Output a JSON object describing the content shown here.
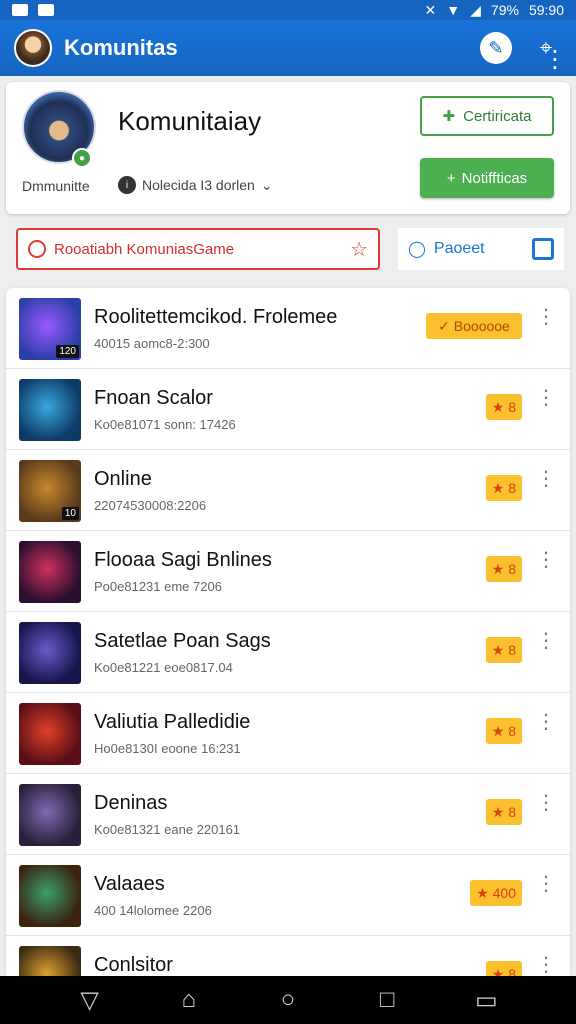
{
  "status": {
    "battery": "79%",
    "time": "59:90"
  },
  "appbar": {
    "title": "Komunitas",
    "button_icon": "edit-icon"
  },
  "profile": {
    "name": "Komunitaiay",
    "subtitle": "Dmmunitte",
    "meta": "Nolecida I3 dorlen",
    "certificate_label": "Certiricata",
    "notification_label": "Notiffticas"
  },
  "search": {
    "value": "Rooatiabh KomuniasGame",
    "post_label": "Paoeet"
  },
  "items": [
    {
      "title": "Roolitettemcikod. Frolemee",
      "subtitle": "40015 aomc8-2:300",
      "badge": "Boooooe",
      "thumb_badge": "120",
      "thumb_color1": "#2b3fa8",
      "thumb_color2": "#9b59ff"
    },
    {
      "title": "Fnoan Scalor",
      "subtitle": "Ko0e81071 sonn: 17426",
      "badge": "8",
      "thumb_badge": "",
      "thumb_color1": "#0d3b66",
      "thumb_color2": "#3aa7e0"
    },
    {
      "title": "Online",
      "subtitle": "22074530008:2206",
      "badge": "8",
      "thumb_badge": "10",
      "thumb_color1": "#5a3a1a",
      "thumb_color2": "#c8892f"
    },
    {
      "title": "Flooaa Sagi Bnlines",
      "subtitle": "Po0e81231 eme 7206",
      "badge": "8",
      "thumb_badge": "",
      "thumb_color1": "#2a0f2f",
      "thumb_color2": "#d03060"
    },
    {
      "title": "Satetlae Poan Sags",
      "subtitle": "Ko0e81221 eoe0817.04",
      "badge": "8",
      "thumb_badge": "",
      "thumb_color1": "#16164a",
      "thumb_color2": "#6a5acd"
    },
    {
      "title": "Valiutia Palledidie",
      "subtitle": "Ho0e8130I eoone 16:231",
      "badge": "8",
      "thumb_badge": "",
      "thumb_color1": "#5a0f16",
      "thumb_color2": "#e0402a"
    },
    {
      "title": "Deninas",
      "subtitle": "Ko0e81321 eane 220161",
      "badge": "8",
      "thumb_badge": "",
      "thumb_color1": "#2a1f3a",
      "thumb_color2": "#7e6bb0"
    },
    {
      "title": "Valaaes",
      "subtitle": "400 14lolomee 2206",
      "badge": "400",
      "thumb_badge": "",
      "thumb_color1": "#3a2410",
      "thumb_color2": "#3aa06a"
    },
    {
      "title": "Conlsitor",
      "subtitle": "",
      "badge": "8",
      "thumb_badge": "",
      "thumb_color1": "#3b2a12",
      "thumb_color2": "#e0a030"
    }
  ],
  "colors": {
    "primary": "#1565c0",
    "accent_green": "#4caf50",
    "badge_yellow": "#fbc02d",
    "search_red": "#e53935"
  }
}
